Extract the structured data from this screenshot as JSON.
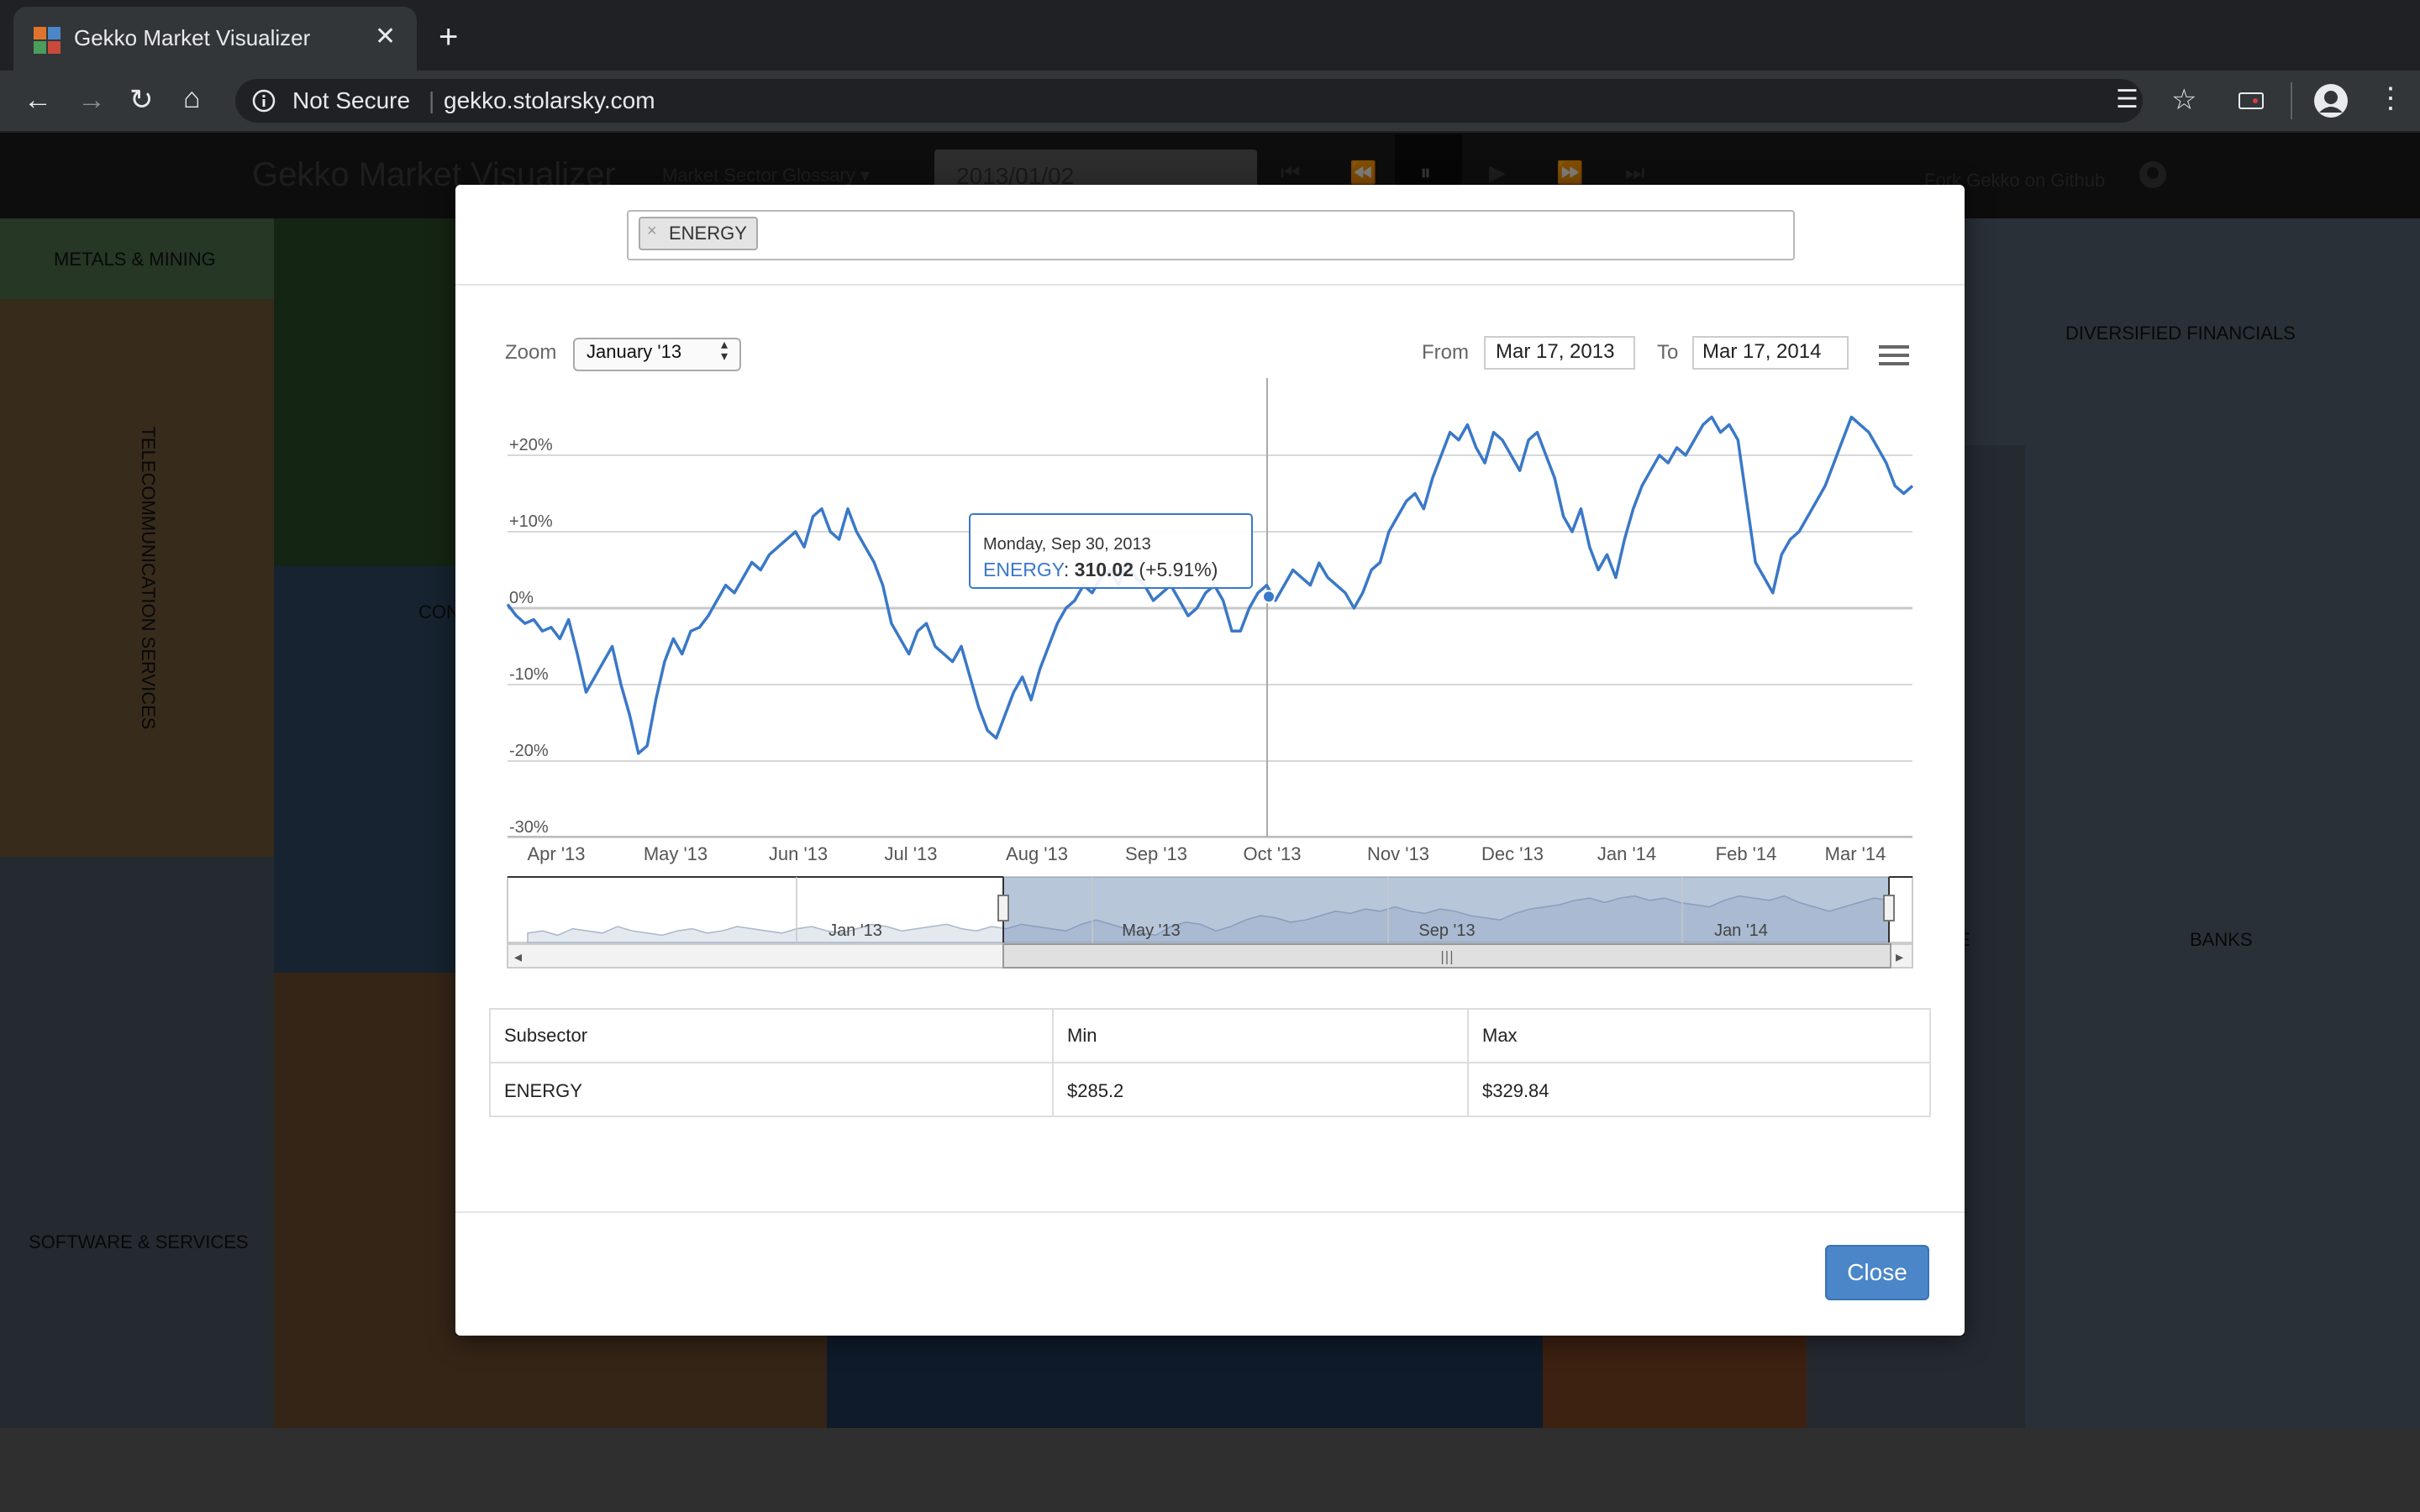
{
  "browser": {
    "tab_title": "Gekko Market Visualizer",
    "security_label": "Not Secure",
    "url": "gekko.stolarsky.com"
  },
  "app": {
    "title": "Gekko Market Visualizer",
    "glossary_label": "Market Sector Glossary",
    "date": "2013/01/02",
    "fork_label": "Fork Gekko on Github",
    "tiles": {
      "metals": "METALS & MINING",
      "telecom": "TELECOMMUNICATION SERVICES",
      "software": "SOFTWARE & SERVICES",
      "diversified": "DIVERSIFIED FINANCIALS",
      "banks": "BANKS",
      "partial_con": "CON",
      "partial_e": "E"
    },
    "colors": {
      "metals": "#4d6e4a",
      "telecom": "#6e5638",
      "green_big": "#2a4a27",
      "blue_mid": "#2f4761",
      "brown_big": "#6b4b2e",
      "slate": "#4a5562",
      "slate_light": "#54606e",
      "navy": "#1f3656",
      "rust": "#7a4322"
    }
  },
  "modal": {
    "chip_label": "ENERGY",
    "zoom_label": "Zoom",
    "zoom_value": "January '13",
    "from_label": "From",
    "from_value": "Mar 17, 2013",
    "to_label": "To",
    "to_value": "Mar 17, 2014",
    "close_label": "Close",
    "table": {
      "headers": [
        "Subsector",
        "Min",
        "Max"
      ],
      "rows": [
        [
          "ENERGY",
          "$285.2",
          "$329.84"
        ]
      ]
    }
  },
  "chart_data": {
    "type": "line",
    "series": [
      {
        "name": "ENERGY",
        "color": "#3a78c8"
      }
    ],
    "y_ticks": [
      "+20%",
      "+10%",
      "0%",
      "-10%",
      "-20%",
      "-30%"
    ],
    "y_range": [
      -30,
      30
    ],
    "x_ticks": [
      "Apr '13",
      "May '13",
      "Jun '13",
      "Jul '13",
      "Aug '13",
      "Sep '13",
      "Oct '13",
      "Nov '13",
      "Dec '13",
      "Jan '14",
      "Feb '14",
      "Mar '14"
    ],
    "navigator_ticks": [
      "Jan '13",
      "May '13",
      "Sep '13",
      "Jan '14"
    ],
    "values_pct": [
      0.5,
      -1,
      -2,
      -1.5,
      -3,
      -2.5,
      -4,
      -1.5,
      -6,
      -11,
      -9,
      -7,
      -5,
      -10,
      -14,
      -19,
      -18,
      -12,
      -7,
      -4,
      -6,
      -3,
      -2.5,
      -1,
      1,
      3,
      2,
      4,
      6,
      5,
      7,
      8,
      9,
      10,
      8,
      12,
      13,
      10,
      9,
      13,
      10,
      8,
      6,
      3,
      -2,
      -4,
      -6,
      -3,
      -2,
      -5,
      -6,
      -7,
      -5,
      -9,
      -13,
      -16,
      -17,
      -14,
      -11,
      -9,
      -12,
      -8,
      -5,
      -2,
      0,
      1,
      3,
      2,
      4,
      5,
      3,
      6,
      4,
      3,
      1,
      2,
      3,
      1,
      -1,
      0,
      2,
      3,
      1,
      -3,
      -3,
      0,
      2,
      3,
      1,
      3,
      5,
      4,
      3,
      5.91,
      4,
      3,
      2,
      0,
      2,
      5,
      6,
      10,
      12,
      14,
      15,
      13,
      17,
      20,
      23,
      22,
      24,
      21,
      19,
      23,
      22,
      20,
      18,
      22,
      23,
      20,
      17,
      12,
      10,
      13,
      8,
      5,
      7,
      4,
      9,
      13,
      16,
      18,
      20,
      19,
      21,
      20,
      22,
      24,
      25,
      23,
      24,
      22,
      14,
      6,
      4,
      2,
      7,
      9,
      10,
      12,
      14,
      16,
      19,
      22,
      25,
      24,
      23,
      21,
      19,
      16,
      15,
      16
    ],
    "tooltip": {
      "date": "Monday, Sep 30, 2013",
      "series": "ENERGY",
      "value": "310.02",
      "change": "(+5.91%)"
    }
  }
}
